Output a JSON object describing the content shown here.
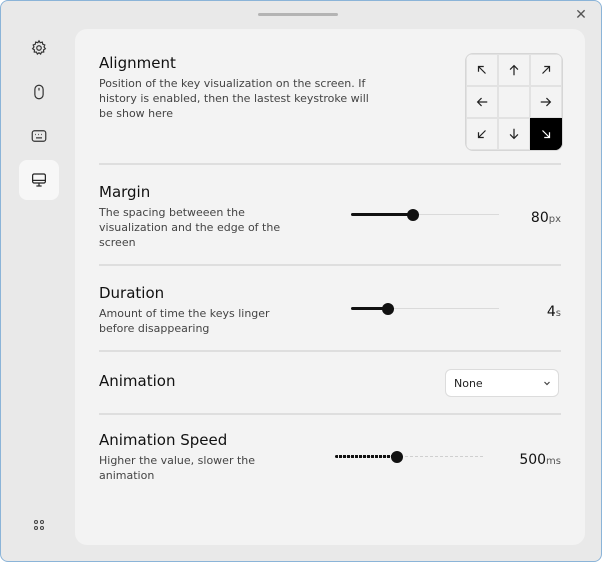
{
  "window": {
    "close_glyph": "✕"
  },
  "sidebar": {
    "items": [
      {
        "name": "settings",
        "icon": "gear-icon"
      },
      {
        "name": "mouse",
        "icon": "mouse-icon"
      },
      {
        "name": "keyboard",
        "icon": "keyboard-icon"
      },
      {
        "name": "display",
        "icon": "monitor-icon",
        "active": true
      }
    ],
    "bottom_icon": "grid-dots-icon"
  },
  "alignment": {
    "title": "Alignment",
    "description": "Position of the key visualization on the screen. If history is enabled, then the lastest keystroke will be show here",
    "options": [
      "top-left",
      "top-center",
      "top-right",
      "middle-left",
      "center",
      "middle-right",
      "bottom-left",
      "bottom-center",
      "bottom-right"
    ],
    "selected": "bottom-right"
  },
  "margin": {
    "title": "Margin",
    "description": "The spacing betweeen the visualization and the edge of the screen",
    "value": "80",
    "unit": "px",
    "fill_fraction": 0.42
  },
  "duration": {
    "title": "Duration",
    "description": "Amount of time the keys linger before disappearing",
    "value": "4",
    "unit": "s",
    "fill_fraction": 0.25
  },
  "animation": {
    "title": "Animation",
    "selected": "None"
  },
  "animation_speed": {
    "title": "Animation Speed",
    "description": "Higher the value, slower the animation",
    "value": "500",
    "unit": "ms",
    "fill_fraction": 0.42
  }
}
